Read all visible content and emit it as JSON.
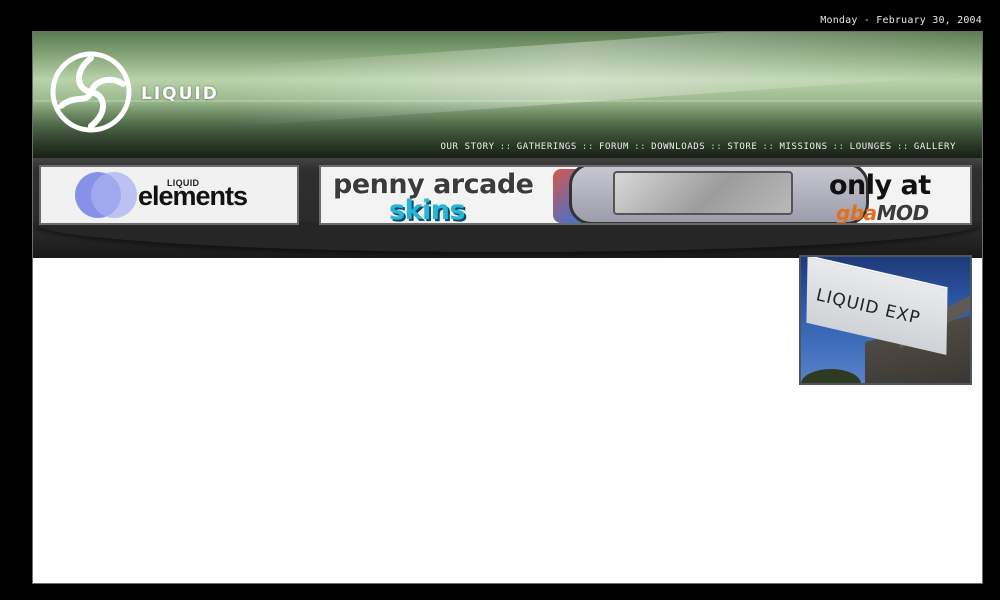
{
  "date": "Monday - February 30, 2004",
  "logo": {
    "text": "LIQUID",
    "icon": "liquid-swirl-logo-icon"
  },
  "nav": {
    "items": [
      {
        "label": "OUR STORY"
      },
      {
        "label": "GATHERINGS"
      },
      {
        "label": "FORUM"
      },
      {
        "label": "DOWNLOADS"
      },
      {
        "label": "STORE"
      },
      {
        "label": "MISSIONS"
      },
      {
        "label": "LOUNGES"
      },
      {
        "label": "GALLERY"
      }
    ],
    "separator": "::"
  },
  "banners": {
    "elements": {
      "small": "LIQUID",
      "big": "elements"
    },
    "penny_arcade": {
      "line1": "penny arcade",
      "line2": "skins",
      "only_at": "only at",
      "gba": "gba",
      "mod": "MOD"
    }
  },
  "photo": {
    "flag_text": "LIQUID EXP"
  },
  "colors": {
    "background": "#000000",
    "content": "#ffffff",
    "header_green": "#8eae80",
    "bar_dark": "#2a2a2a"
  }
}
